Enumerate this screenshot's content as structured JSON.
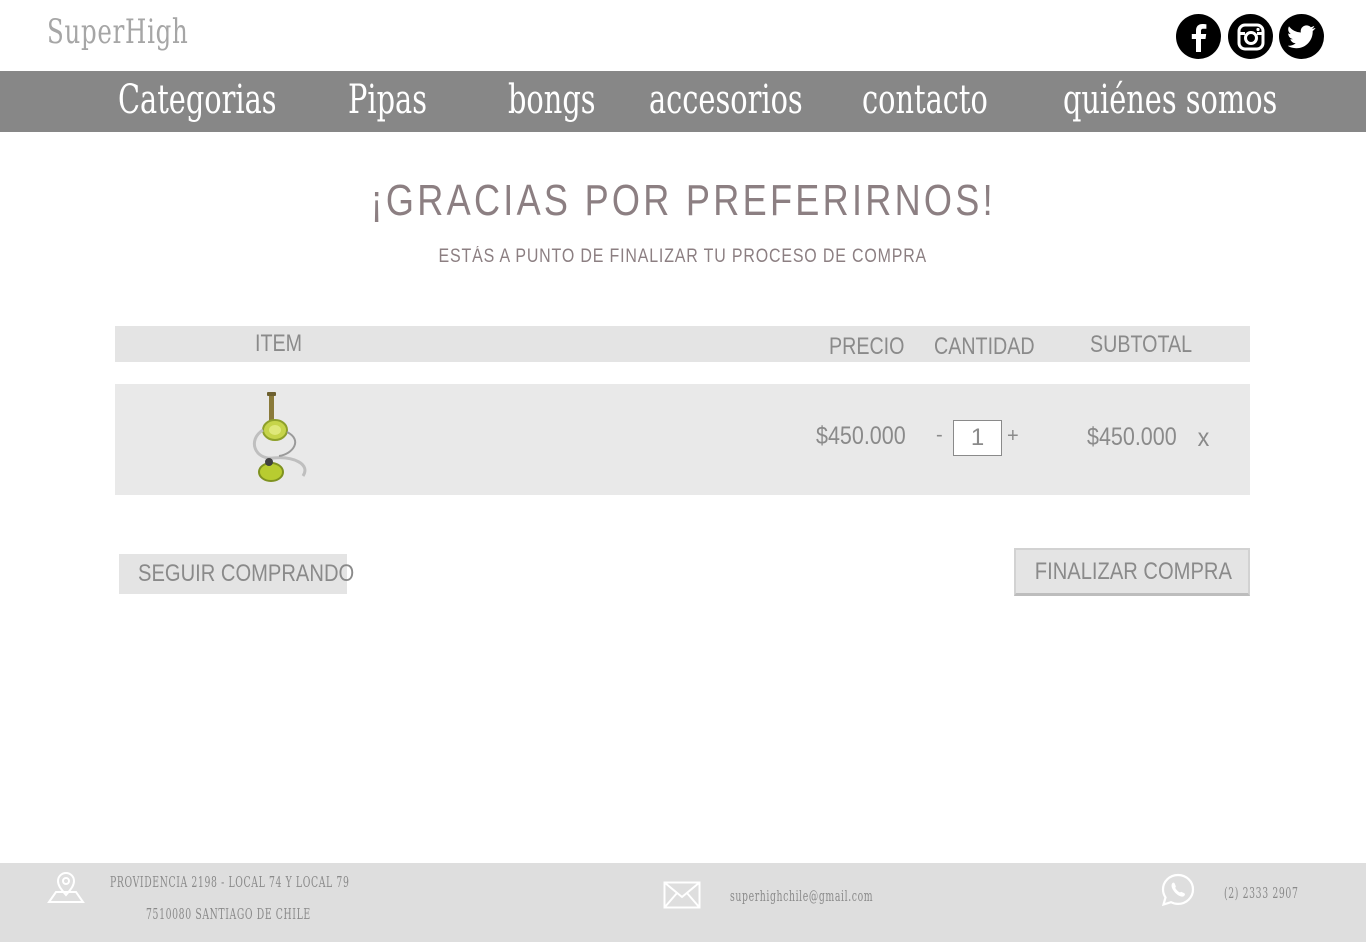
{
  "header": {
    "logo": "SuperHigh",
    "social": [
      "facebook-icon",
      "instagram-icon",
      "twitter-icon"
    ]
  },
  "nav": {
    "items": [
      "Categorias",
      "Pipas",
      "bongs",
      "accesorios",
      "contacto",
      "quiénes somos"
    ]
  },
  "main": {
    "title": "¡GRACIAS POR PREFERIRNOS!",
    "subtitle": "ESTÁS A PUNTO DE FINALIZAR TU PROCESO DE COMPRA"
  },
  "cart": {
    "columns": {
      "item": "ITEM",
      "precio": "PRECIO",
      "cantidad": "CANTIDAD",
      "subtotal": "SUBTOTAL"
    },
    "rows": [
      {
        "image": "hookah-product-image",
        "precio": "$450.000",
        "cantidad": "1",
        "minus": "-",
        "plus": "+",
        "subtotal": "$450.000",
        "remove": "x"
      }
    ]
  },
  "actions": {
    "continue": "SEGUIR COMPRANDO",
    "checkout": "FINALIZAR COMPRA"
  },
  "footer": {
    "address_line1": "PROVIDENCIA 2198 - LOCAL 74 Y LOCAL 79",
    "address_line2": "7510080 SANTIAGO DE CHILE",
    "email": "superhighchile@gmail.com",
    "phone": "(2) 2333 2907"
  },
  "colors": {
    "nav_bg": "#878787",
    "title": "#8c7f82",
    "table_bg": "#e4e4e4",
    "footer_bg": "#dedede"
  }
}
